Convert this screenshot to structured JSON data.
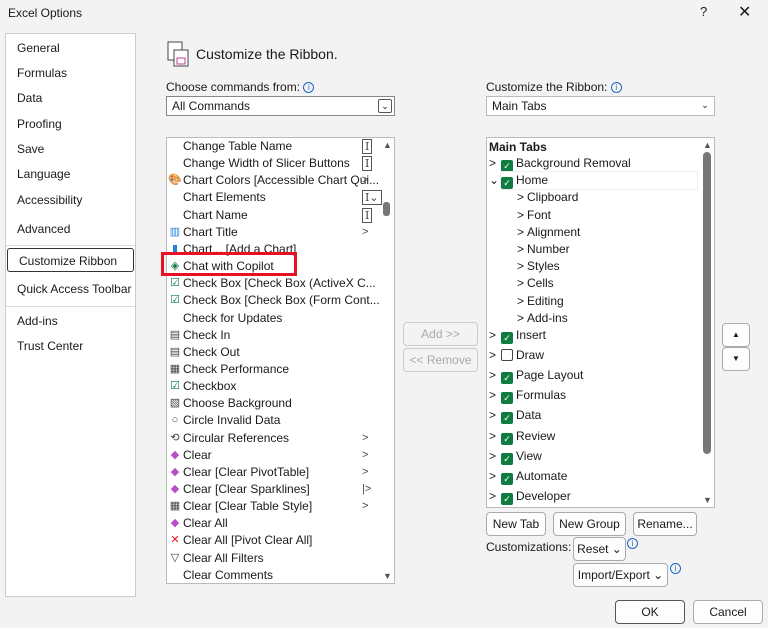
{
  "window": {
    "title": "Excel Options",
    "help": "?",
    "close": "✕"
  },
  "nav": {
    "items": [
      "General",
      "Formulas",
      "Data",
      "Proofing",
      "Save",
      "Language",
      "Accessibility",
      "Advanced",
      "Customize Ribbon",
      "Quick Access Toolbar",
      "Add-ins",
      "Trust Center"
    ],
    "selected": "Customize Ribbon"
  },
  "header": {
    "title": "Customize the Ribbon."
  },
  "left": {
    "label": "Choose commands from:",
    "value": "All Commands",
    "items": [
      {
        "t": "Change Table Name",
        "i": "",
        "r": "I"
      },
      {
        "t": "Change Width of Slicer Buttons",
        "i": "",
        "r": "I"
      },
      {
        "t": "Chart Colors [Accessible Chart Qui...",
        "i": "palette-icon",
        "r": ">"
      },
      {
        "t": "Chart Elements",
        "i": "",
        "r": "I⌄"
      },
      {
        "t": "Chart Name",
        "i": "",
        "r": "I"
      },
      {
        "t": "Chart Title",
        "i": "chart-title-icon",
        "r": ">"
      },
      {
        "t": "Chart... [Add a Chart]",
        "i": "chart-icon",
        "r": ""
      },
      {
        "t": "Chat with Copilot",
        "i": "copilot-icon",
        "r": ""
      },
      {
        "t": "Check Box [Check Box (ActiveX C...",
        "i": "checkbox-icon",
        "r": ""
      },
      {
        "t": "Check Box [Check Box (Form Cont...",
        "i": "checkbox-icon",
        "r": ""
      },
      {
        "t": "Check for Updates",
        "i": "",
        "r": ""
      },
      {
        "t": "Check In",
        "i": "document-icon",
        "r": ""
      },
      {
        "t": "Check Out",
        "i": "document-icon",
        "r": ""
      },
      {
        "t": "Check Performance",
        "i": "grid-icon",
        "r": ""
      },
      {
        "t": "Checkbox",
        "i": "checkbox-icon",
        "r": ""
      },
      {
        "t": "Choose Background",
        "i": "image-icon",
        "r": ""
      },
      {
        "t": "Circle Invalid Data",
        "i": "circle-icon",
        "r": ""
      },
      {
        "t": "Circular References",
        "i": "references-icon",
        "r": ">"
      },
      {
        "t": "Clear",
        "i": "eraser-icon",
        "r": ">"
      },
      {
        "t": "Clear [Clear PivotTable]",
        "i": "eraser-icon",
        "r": ">"
      },
      {
        "t": "Clear [Clear Sparklines]",
        "i": "eraser-icon",
        "r": "|>"
      },
      {
        "t": "Clear [Clear Table Style]",
        "i": "table-icon",
        "r": ">"
      },
      {
        "t": "Clear All",
        "i": "eraser-icon",
        "r": ""
      },
      {
        "t": "Clear All [Pivot Clear All]",
        "i": "x-icon",
        "r": ""
      },
      {
        "t": "Clear All Filters",
        "i": "filter-icon",
        "r": ""
      },
      {
        "t": "Clear Comments",
        "i": "",
        "r": ""
      }
    ]
  },
  "middle": {
    "add": "Add >>",
    "remove": "<< Remove"
  },
  "right": {
    "label": "Customize the Ribbon:",
    "value": "Main Tabs",
    "heading": "Main Tabs",
    "items": [
      {
        "t": "Background Removal",
        "lvl": 0,
        "exp": ">",
        "cb": true
      },
      {
        "t": "Home",
        "lvl": 0,
        "exp": "⌄",
        "cb": true
      },
      {
        "t": "Clipboard",
        "lvl": 1,
        "exp": ">"
      },
      {
        "t": "Font",
        "lvl": 1,
        "exp": ">"
      },
      {
        "t": "Alignment",
        "lvl": 1,
        "exp": ">"
      },
      {
        "t": "Number",
        "lvl": 1,
        "exp": ">"
      },
      {
        "t": "Styles",
        "lvl": 1,
        "exp": ">"
      },
      {
        "t": "Cells",
        "lvl": 1,
        "exp": ">"
      },
      {
        "t": "Editing",
        "lvl": 1,
        "exp": ">"
      },
      {
        "t": "Add-ins",
        "lvl": 1,
        "exp": ">"
      },
      {
        "t": "Insert",
        "lvl": 0,
        "exp": ">",
        "cb": true
      },
      {
        "t": "Draw",
        "lvl": 0,
        "exp": ">",
        "cb": false
      },
      {
        "t": "Page Layout",
        "lvl": 0,
        "exp": ">",
        "cb": true
      },
      {
        "t": "Formulas",
        "lvl": 0,
        "exp": ">",
        "cb": true
      },
      {
        "t": "Data",
        "lvl": 0,
        "exp": ">",
        "cb": true
      },
      {
        "t": "Review",
        "lvl": 0,
        "exp": ">",
        "cb": true
      },
      {
        "t": "View",
        "lvl": 0,
        "exp": ">",
        "cb": true
      },
      {
        "t": "Automate",
        "lvl": 0,
        "exp": ">",
        "cb": true
      },
      {
        "t": "Developer",
        "lvl": 0,
        "exp": ">",
        "cb": true
      }
    ],
    "new_tab": "New Tab",
    "new_group": "New Group",
    "rename": "Rename...",
    "customizations": "Customizations:",
    "reset": "Reset ⌄",
    "import_export": "Import/Export ⌄"
  },
  "footer": {
    "ok": "OK",
    "cancel": "Cancel"
  },
  "colors": {
    "highlight": "#e81123",
    "check": "#107c41"
  }
}
